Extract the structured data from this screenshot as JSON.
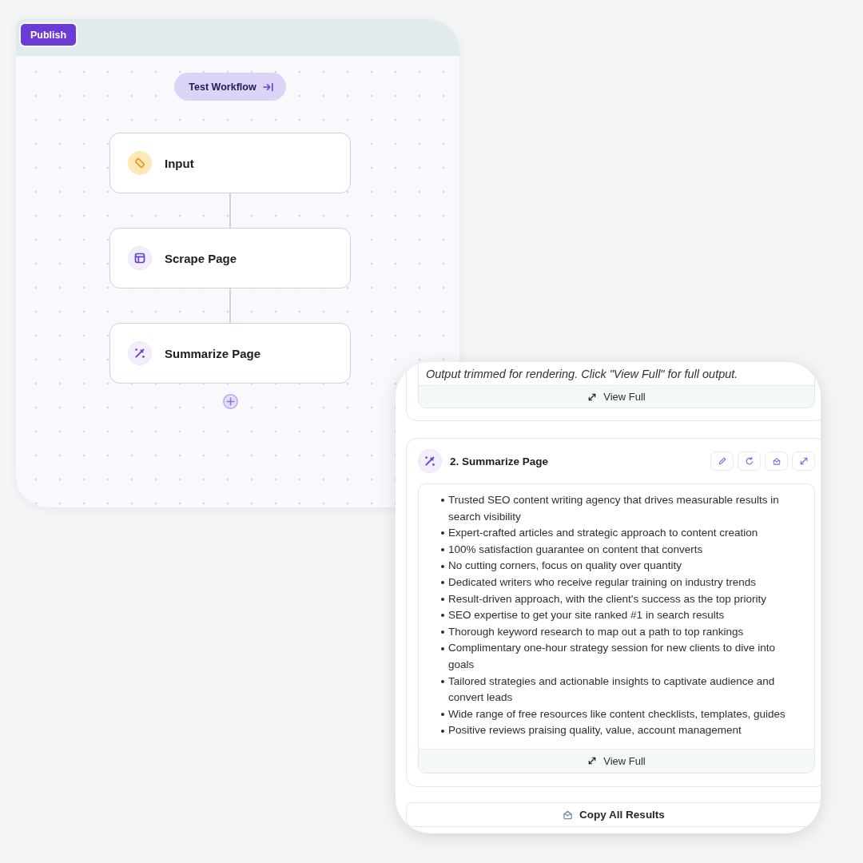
{
  "workflow_editor": {
    "publish_button": "Publish",
    "test_button": "Test Workflow",
    "nodes": [
      {
        "label": "Input",
        "kind": "input"
      },
      {
        "label": "Scrape Page",
        "kind": "scrape"
      },
      {
        "label": "Summarize Page",
        "kind": "summarize"
      }
    ]
  },
  "results_panel": {
    "previous_result": {
      "notice": "Output trimmed for rendering. Click \"View Full\" for full output.",
      "view_full": "View Full"
    },
    "result": {
      "title": "2. Summarize Page",
      "kind": "summarize",
      "bullets": [
        "Trusted SEO content writing agency that drives measurable results in search visibility",
        "Expert-crafted articles and strategic approach to content creation",
        "100% satisfaction guarantee on content that converts",
        "No cutting corners, focus on quality over quantity",
        "Dedicated writers who receive regular training on industry trends",
        "Result-driven approach, with the client's success as the top priority",
        "SEO expertise to get your site ranked #1 in search results",
        "Thorough keyword research to map out a path to top rankings",
        "Complimentary one-hour strategy session for new clients to dive into goals",
        "Tailored strategies and actionable insights to captivate audience and convert leads",
        "Wide range of free resources like content checklists, templates, guides",
        "Positive reviews praising quality, value, account management"
      ],
      "view_full": "View Full"
    },
    "copy_all": "Copy All Results"
  }
}
